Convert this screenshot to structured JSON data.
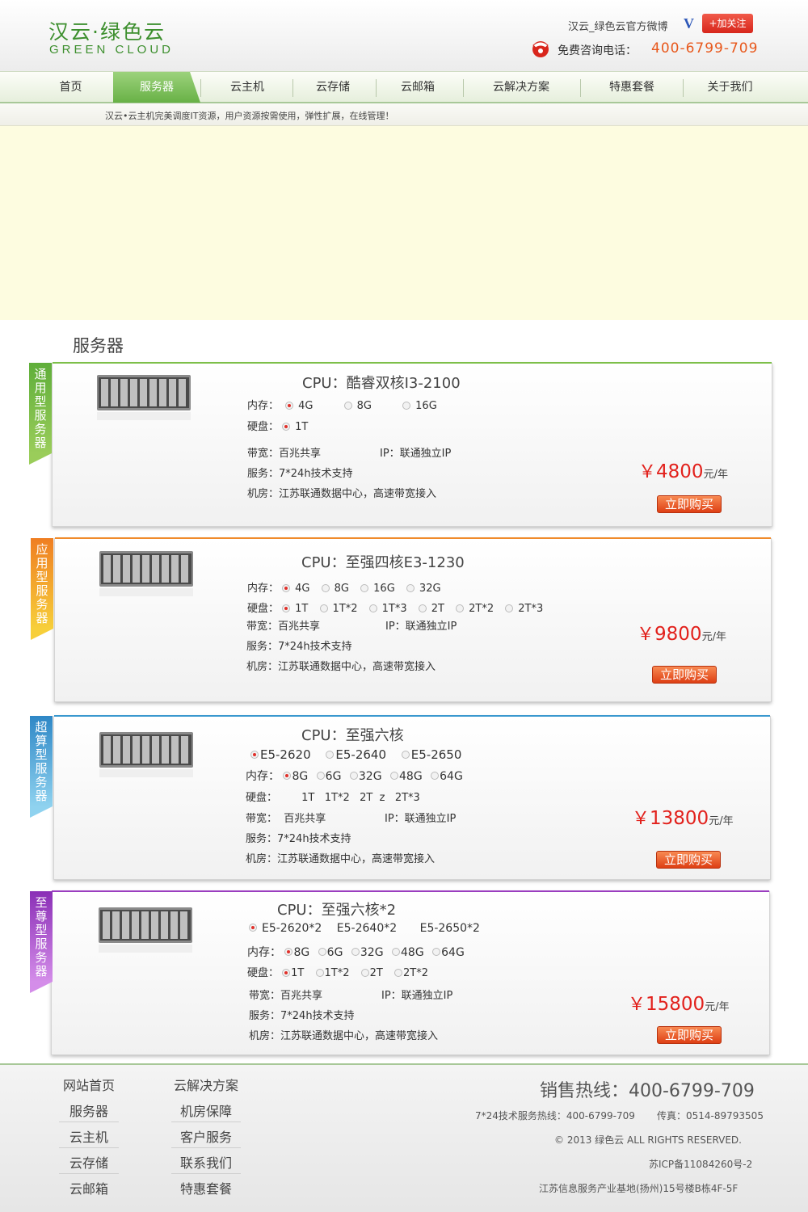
{
  "header": {
    "logo_cn": "汉云·绿色云",
    "logo_en": "GREEN CLOUD",
    "weibo_label": "汉云_绿色云官方微博",
    "weibo_v": "V",
    "follow_label": "+加关注",
    "hotline_label": "免费咨询电话：",
    "hotline_number": "400-6799-709"
  },
  "nav": {
    "items": [
      {
        "label": "首页"
      },
      {
        "label": "服务器"
      },
      {
        "label": "云主机"
      },
      {
        "label": "云存储"
      },
      {
        "label": "云邮箱"
      },
      {
        "label": "云解决方案"
      },
      {
        "label": "特惠套餐"
      },
      {
        "label": "关于我们"
      }
    ],
    "active": "服务器"
  },
  "slogan": "汉云•云主机完美调度IT资源，用户资源按需使用，弹性扩展，在线管理！",
  "section_title": "服务器",
  "products": [
    {
      "ribbon": "通用型服务器",
      "color": "#7dbf4a",
      "cpu": "CPU：酷睿双核I3-2100",
      "mem_label": "内存：",
      "mem_options": [
        "4G",
        "8G",
        "16G"
      ],
      "disk_label": "硬盘：",
      "disk_options": [
        "1T"
      ],
      "bandwidth": "带宽：百兆共享",
      "ip": "IP：联通独立IP",
      "service": "服务：7*24h技术支持",
      "room": "机房：江苏联通数据中心，高速带宽接入",
      "currency": "￥",
      "price": "4800",
      "unit": "元/年",
      "buy": "立即购买"
    },
    {
      "ribbon": "应用型服务器",
      "color": "#f08a2a",
      "cpu": "CPU：至强四核E3-1230",
      "mem_label": "内存：",
      "mem_options": [
        "4G",
        "8G",
        "16G",
        "32G"
      ],
      "disk_label": "硬盘：",
      "disk_options": [
        "1T",
        "1T*2",
        "1T*3",
        "2T",
        "2T*2",
        "2T*3"
      ],
      "bandwidth": "带宽：百兆共享",
      "ip": "IP：联通独立IP",
      "service": "服务：7*24h技术支持",
      "room": "机房：江苏联通数据中心，高速带宽接入",
      "currency": "￥",
      "price": "9800",
      "unit": "元/年",
      "buy": "立即购买"
    },
    {
      "ribbon": "超算型服务器",
      "color": "#3a98cf",
      "cpu": "CPU：至强六核",
      "cpu_options": [
        "E5-2620",
        "E5-2640",
        "E5-2650"
      ],
      "mem_label": "内存：",
      "mem_options": [
        "8G",
        "6G",
        "32G",
        "48G",
        "64G"
      ],
      "disk_label": "硬盘：",
      "disk_text": "1T   1T*2   2T  z   2T*3",
      "bandwidth": "带宽：  百兆共享",
      "ip": "IP：联通独立IP",
      "service": "服务：7*24h技术支持",
      "room": "机房：江苏联通数据中心，高速带宽接入",
      "currency": "￥",
      "price": "13800",
      "unit": "元/年",
      "buy": "立即购买"
    },
    {
      "ribbon": "至尊型服务器",
      "color": "#9a3dbf",
      "cpu": "CPU：至强六核*2",
      "cpu_options": [
        "E5-2620*2",
        "E5-2640*2",
        "E5-2650*2"
      ],
      "mem_label": "内存：",
      "mem_options": [
        "8G",
        "6G",
        "32G",
        "48G",
        "64G"
      ],
      "disk_label": "硬盘：",
      "disk_options": [
        "1T",
        "1T*2",
        "2T",
        "2T*2"
      ],
      "bandwidth": "带宽：百兆共享",
      "ip": "IP：联通独立IP",
      "service": "服务：7*24h技术支持",
      "room": "机房：江苏联通数据中心，高速带宽接入",
      "currency": "￥",
      "price": "15800",
      "unit": "元/年",
      "buy": "立即购买"
    }
  ],
  "footer": {
    "col1": [
      "网站首页",
      "服务器",
      "云主机",
      "云存储",
      "云邮箱"
    ],
    "col2": [
      "云解决方案",
      "机房保障",
      "客户服务",
      "联系我们",
      "特惠套餐"
    ],
    "sales": "销售热线：400-6799-709",
    "support": "7*24技术服务热线：400-6799-709",
    "fax": "传真：0514-89793505",
    "copyright": "© 2013 绿色云    ALL RIGHTS RESERVED.",
    "icp": "苏ICP备11084260号-2",
    "address": "江苏信息服务产业基地(扬州)15号楼B栋4F-5F"
  }
}
